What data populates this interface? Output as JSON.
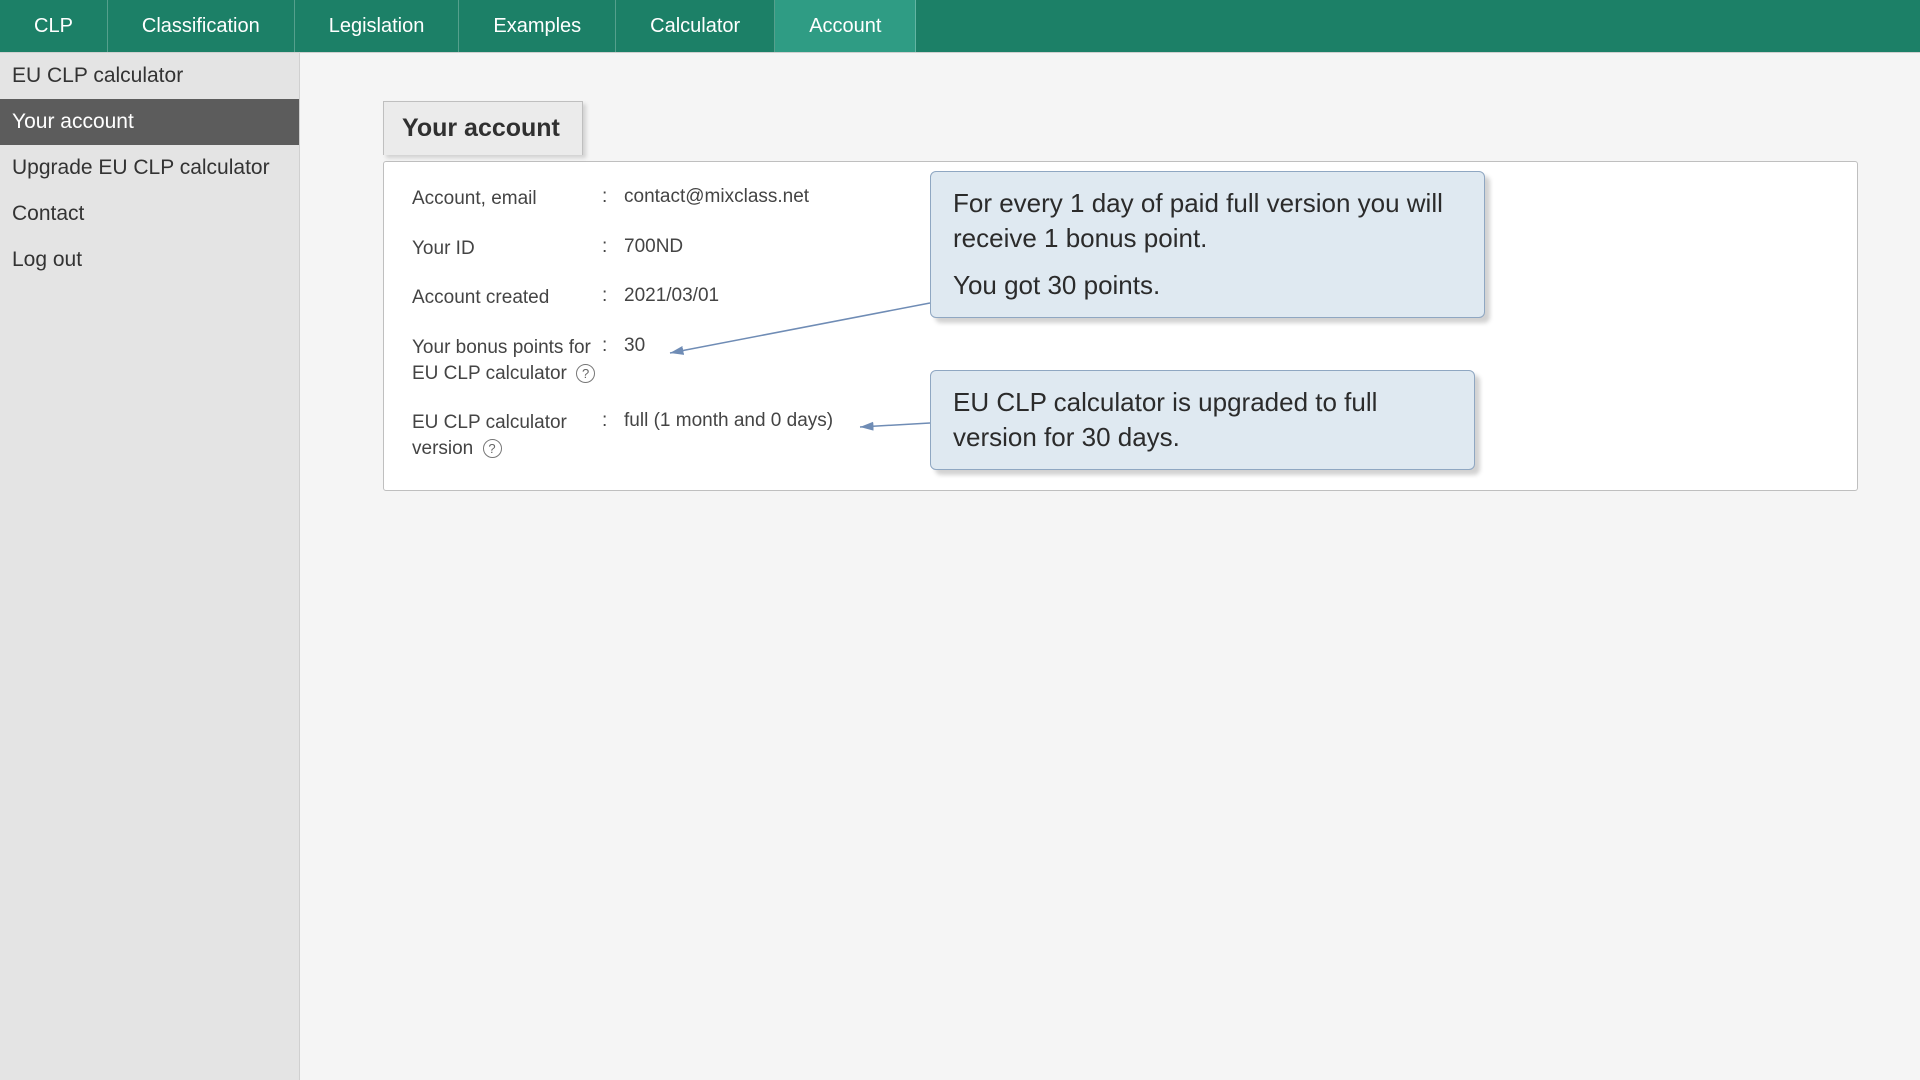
{
  "topnav": {
    "items": [
      {
        "label": "CLP"
      },
      {
        "label": "Classification"
      },
      {
        "label": "Legislation"
      },
      {
        "label": "Examples"
      },
      {
        "label": "Calculator"
      },
      {
        "label": "Account",
        "active": true
      }
    ]
  },
  "sidebar": {
    "items": [
      {
        "label": "EU CLP calculator"
      },
      {
        "label": "Your account",
        "active": true
      },
      {
        "label": "Upgrade EU CLP calculator"
      },
      {
        "label": "Contact"
      },
      {
        "label": "Log out"
      }
    ]
  },
  "panel": {
    "title": "Your account",
    "fields": {
      "email_label": "Account, email",
      "email_value": "contact@mixclass.net",
      "id_label": "Your ID",
      "id_value": "700ND",
      "created_label": "Account created",
      "created_value": "2021/03/01",
      "bonus_label": "Your bonus points for EU CLP calculator",
      "bonus_value": "30",
      "version_label": "EU CLP calculator version",
      "version_value": "full (1 month and 0 days)"
    }
  },
  "callouts": {
    "bonus": {
      "line1": "For every 1 day of paid full version you will receive 1 bonus point.",
      "line2": "You got 30 points."
    },
    "version": {
      "line1": "EU CLP calculator is upgraded to full version for 30 days."
    }
  },
  "symbols": {
    "colon": ":",
    "help": "?"
  }
}
